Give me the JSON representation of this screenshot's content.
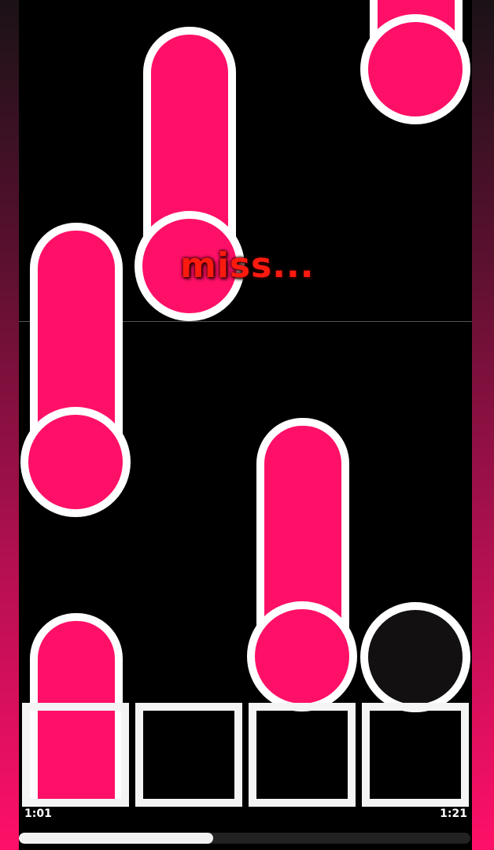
{
  "colors": {
    "note": "#ff1068",
    "note_border": "#ffffff",
    "background": "#000000",
    "judgement": "#ff1a10"
  },
  "judgement": {
    "text": "miss..."
  },
  "lanes": 4,
  "hud": {
    "elapsed": "1:01",
    "total": "1:21",
    "progress": 0.43
  }
}
